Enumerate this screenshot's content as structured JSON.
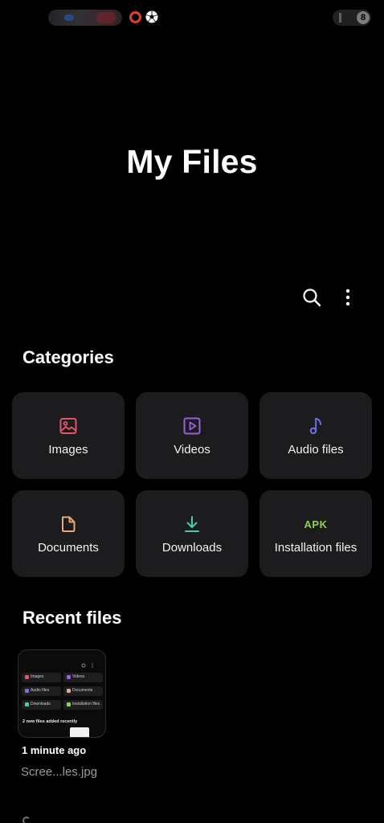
{
  "app": {
    "title": "My Files"
  },
  "status_bar": {
    "battery_glyph": "8"
  },
  "toolbar": {
    "search_icon": "search-icon",
    "more_icon": "more-vertical-icon"
  },
  "categories": {
    "title": "Categories",
    "items": [
      {
        "label": "Images",
        "icon": "image-icon",
        "color": "#e0566f"
      },
      {
        "label": "Videos",
        "icon": "video-icon",
        "color": "#9b5fe0"
      },
      {
        "label": "Audio files",
        "icon": "music-note-icon",
        "color": "#6f6ff0"
      },
      {
        "label": "Documents",
        "icon": "document-icon",
        "color": "#e8a77a"
      },
      {
        "label": "Downloads",
        "icon": "download-icon",
        "color": "#4fc9a6"
      },
      {
        "label": "Installation files",
        "icon": "apk-icon",
        "icon_text": "APK",
        "color": "#8fd14f"
      }
    ]
  },
  "recent": {
    "title": "Recent files",
    "items": [
      {
        "time": "1 minute ago",
        "name": "Scree...les.jpg",
        "thumbnail": {
          "tiles": [
            "Images",
            "Videos",
            "Audio files",
            "Documents",
            "Downloads",
            "Installation files"
          ],
          "note": "2 new files added recently"
        }
      }
    ]
  }
}
